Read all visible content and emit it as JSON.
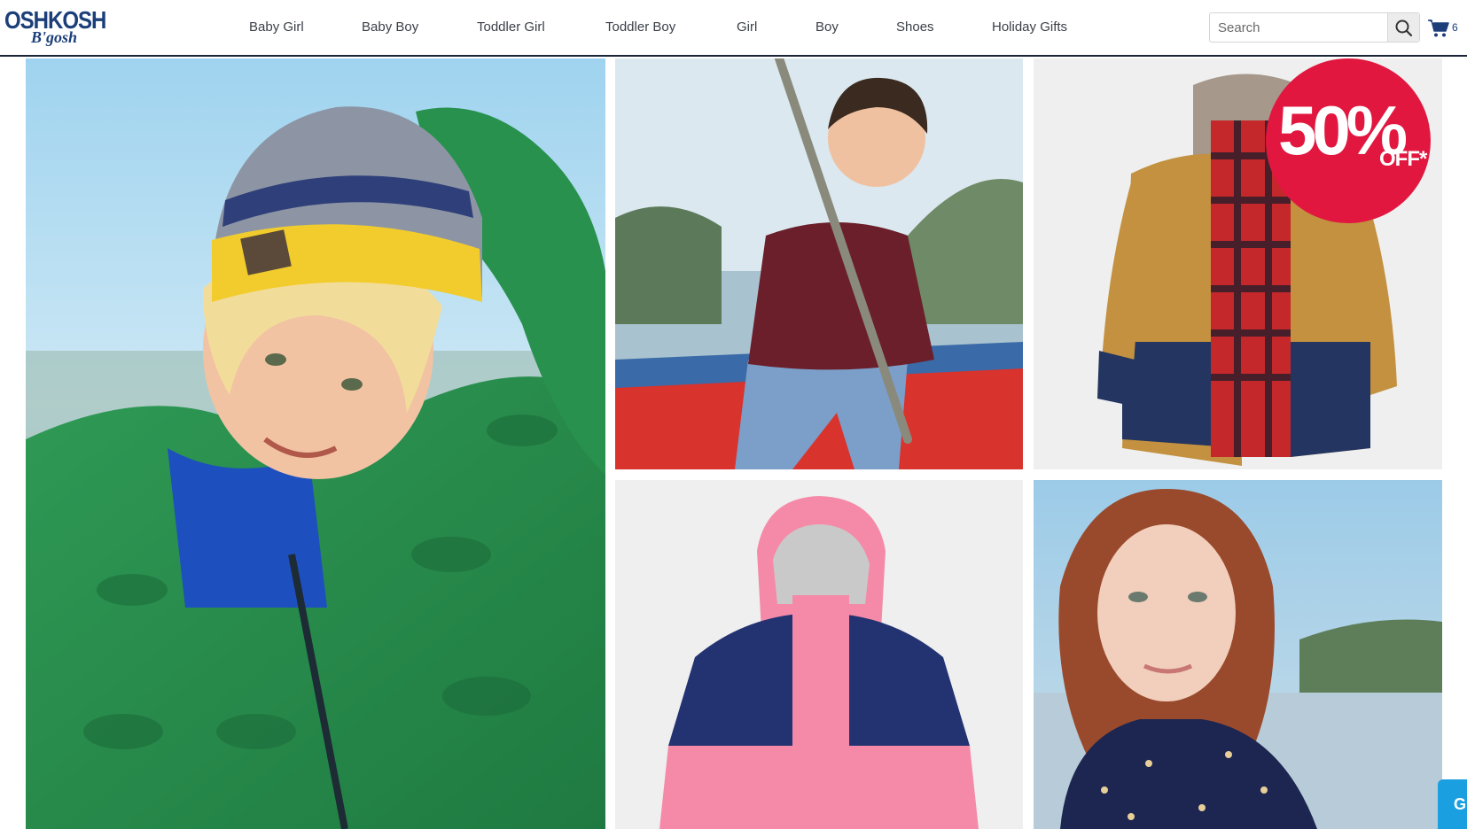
{
  "brand": {
    "logo_top": "OSHKOSH",
    "logo_bottom": "B'gosh"
  },
  "nav": [
    {
      "label": "Baby Girl"
    },
    {
      "label": "Baby Boy"
    },
    {
      "label": "Toddler Girl"
    },
    {
      "label": "Toddler Boy"
    },
    {
      "label": "Girl"
    },
    {
      "label": "Boy"
    },
    {
      "label": "Shoes"
    },
    {
      "label": "Holiday Gifts"
    }
  ],
  "search": {
    "placeholder": "Search",
    "icon": "search-icon"
  },
  "cart": {
    "icon": "cart-icon",
    "count": "6"
  },
  "promo": {
    "percent": "50%",
    "off": "OFF*"
  },
  "chat": {
    "label": "G"
  },
  "colors": {
    "brand_navy": "#1c3f7a",
    "sale_red": "#e1173f",
    "chat_blue": "#1a9fe0"
  }
}
